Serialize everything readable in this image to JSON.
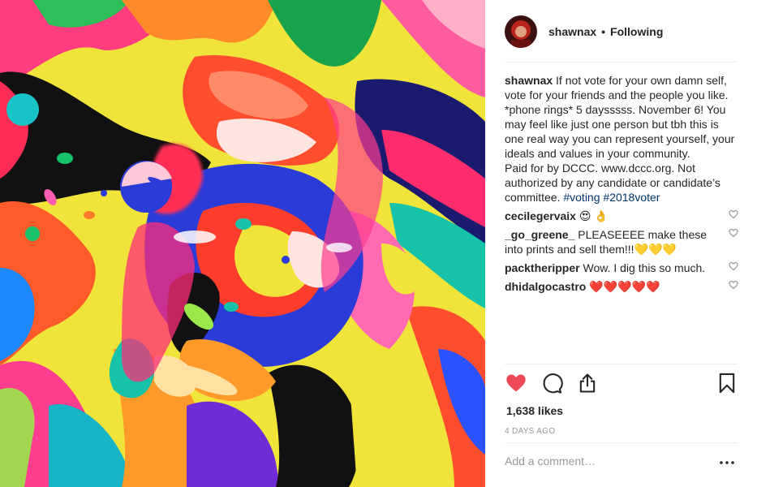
{
  "post": {
    "image_alt": "abstract colorful psychedelic artwork of an open mouth",
    "header": {
      "username": "shawnax",
      "separator": "•",
      "follow_status": "Following"
    },
    "caption": {
      "username": "shawnax",
      "text": "If not vote for your own damn self, vote for your friends and the people you like. *phone rings* 5 daysssss. November 6! You may feel like just one person but tbh this is one real way you can represent yourself, your ideals and values in your community.\nPaid for by DCCC. www.dccc.org. Not authorized by any candidate or candidate’s committee. ",
      "hashtag1": "#voting",
      "hashtag2": "#2018voter"
    },
    "comments": [
      {
        "username": "cecilegervaix",
        "text": "😍 👌"
      },
      {
        "username": "_go_greene_",
        "text": "PLEASEEEE make these into prints and sell them!!!💛💛💛"
      },
      {
        "username": "packtheripper",
        "text": "Wow. I dig this so much."
      },
      {
        "username": "dhidalgocastro",
        "text": "❤️❤️❤️❤️❤️"
      }
    ],
    "likes": "1,638 likes",
    "date": "4 DAYS AGO",
    "add_comment_placeholder": "Add a comment…",
    "more_label": "•••",
    "colors": {
      "like_red": "#ed4956",
      "hashtag_blue": "#003569",
      "muted_gray": "#999999"
    },
    "icons": [
      "heart-filled-icon",
      "comment-icon",
      "share-icon",
      "bookmark-icon",
      "heart-outline-icon",
      "more-options-icon"
    ]
  }
}
